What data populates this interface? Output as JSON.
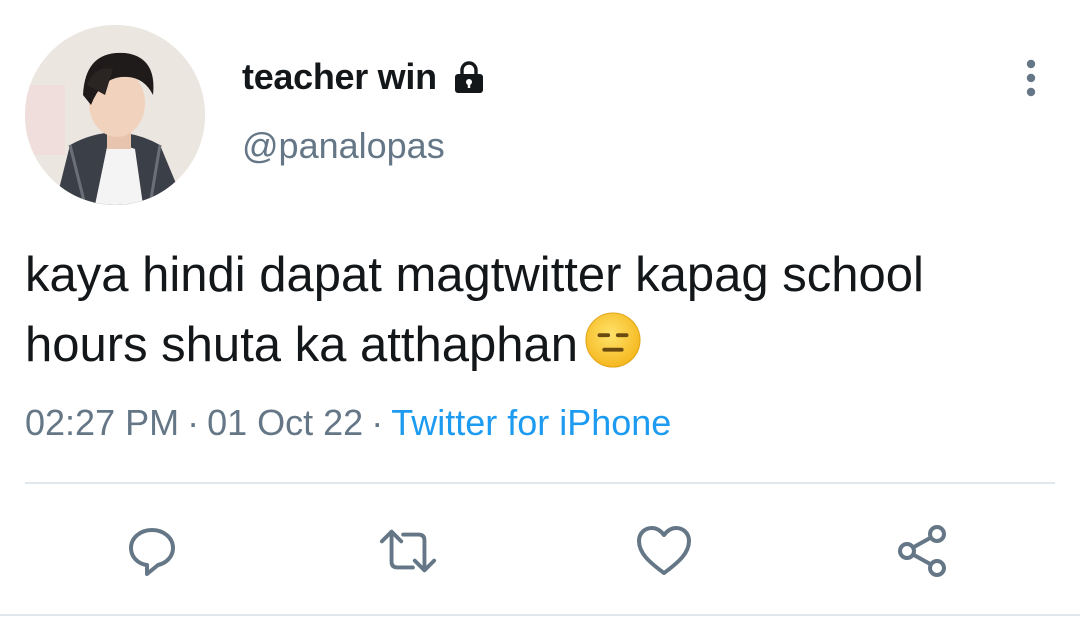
{
  "user": {
    "display_name": "teacher win",
    "handle": "@panalopas",
    "avatar_icon": "avatar-photo",
    "protected_icon": "lock-icon"
  },
  "tweet": {
    "line1": "kaya hindi dapat magtwitter kapag school",
    "line2": "hours shuta ka atthaphan",
    "emoji_icon": "expressionless-face-emoji"
  },
  "meta": {
    "time": "02:27 PM",
    "date": "01 Oct 22",
    "separator": "·",
    "source": "Twitter for iPhone"
  },
  "actions": [
    {
      "name": "reply",
      "icon": "reply-icon"
    },
    {
      "name": "retweet",
      "icon": "retweet-icon"
    },
    {
      "name": "like",
      "icon": "heart-icon"
    },
    {
      "name": "share",
      "icon": "share-icon"
    }
  ],
  "colors": {
    "text": "#14171a",
    "secondary": "#657786",
    "link": "#1d9bf0",
    "divider": "#e1e8ed"
  }
}
